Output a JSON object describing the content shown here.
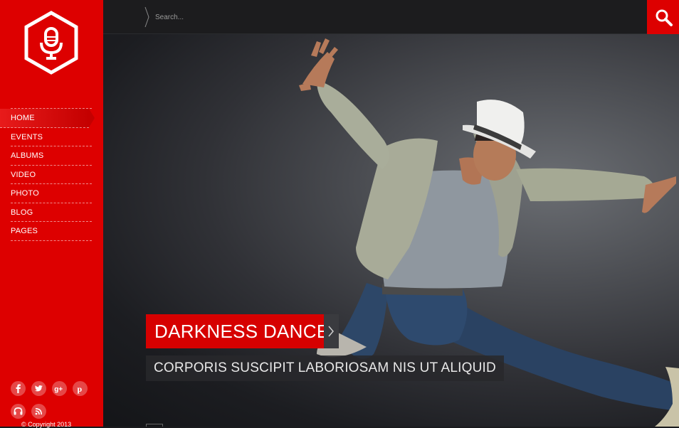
{
  "search": {
    "placeholder": "Search..."
  },
  "nav": {
    "items": [
      "HOME",
      "EVENTS",
      "ALBUMS",
      "VIDEO",
      "PHOTO",
      "BLOG",
      "PAGES"
    ],
    "active": "HOME"
  },
  "slider": {
    "title": "DARKNESS DANCE",
    "subtitle": "CORPORIS SUSCIPIT LABORIOSAM NIS UT ALIQUID"
  },
  "footer": {
    "copyright": "© Copyright 2013"
  },
  "socials": [
    "facebook-icon",
    "twitter-icon",
    "google-plus-icon",
    "pinterest-icon",
    "headphones-icon",
    "rss-icon"
  ],
  "colors": {
    "accent": "#dd0000",
    "topbar": "#1c1c1e"
  }
}
